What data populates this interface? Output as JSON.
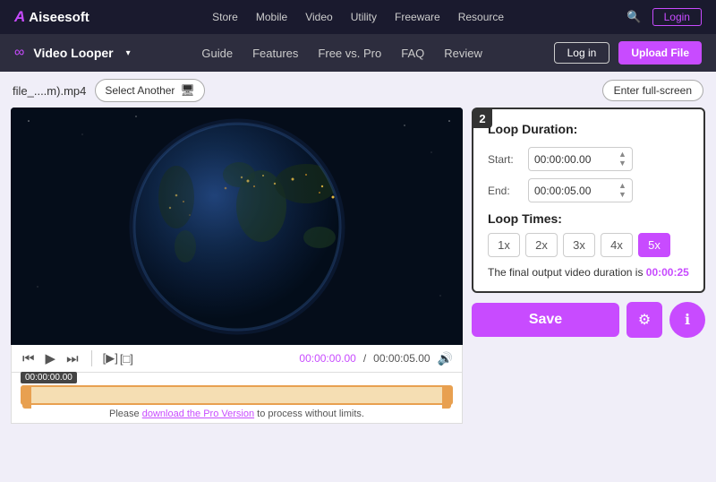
{
  "topnav": {
    "logo": "Aiseesoft",
    "logo_a": "A",
    "links": [
      "Store",
      "Mobile",
      "Video",
      "Utility",
      "Freeware",
      "Resource"
    ],
    "login_label": "Login"
  },
  "secondnav": {
    "app_title": "Video Looper",
    "links": [
      "Guide",
      "Features",
      "Free vs. Pro",
      "FAQ",
      "Review"
    ],
    "login_label": "Log in",
    "upload_label": "Upload File"
  },
  "file_bar": {
    "file_name": "file_....m).mp4",
    "select_another": "Select Another",
    "fullscreen": "Enter full-screen"
  },
  "controls": {
    "time_current": "00:00:00.00",
    "time_separator": "/",
    "time_total": "00:00:05.00"
  },
  "timeline": {
    "time_label": "00:00:00.00",
    "pro_message_prefix": "Please ",
    "pro_link": "download the Pro Version",
    "pro_message_suffix": " to process without limits."
  },
  "loop_duration": {
    "box_number": "2",
    "title": "Loop Duration:",
    "start_label": "Start:",
    "start_value": "00:00:00.00",
    "end_label": "End:",
    "end_value": "00:00:05.00",
    "loop_times_title": "Loop Times:",
    "buttons": [
      "1x",
      "2x",
      "3x",
      "4x",
      "5x"
    ],
    "active_button": "5x",
    "output_prefix": "The final output video duration is ",
    "output_time": "00:00:25"
  },
  "save_bar": {
    "save_label": "Save",
    "settings_icon": "⚙",
    "info_icon": "ℹ"
  }
}
